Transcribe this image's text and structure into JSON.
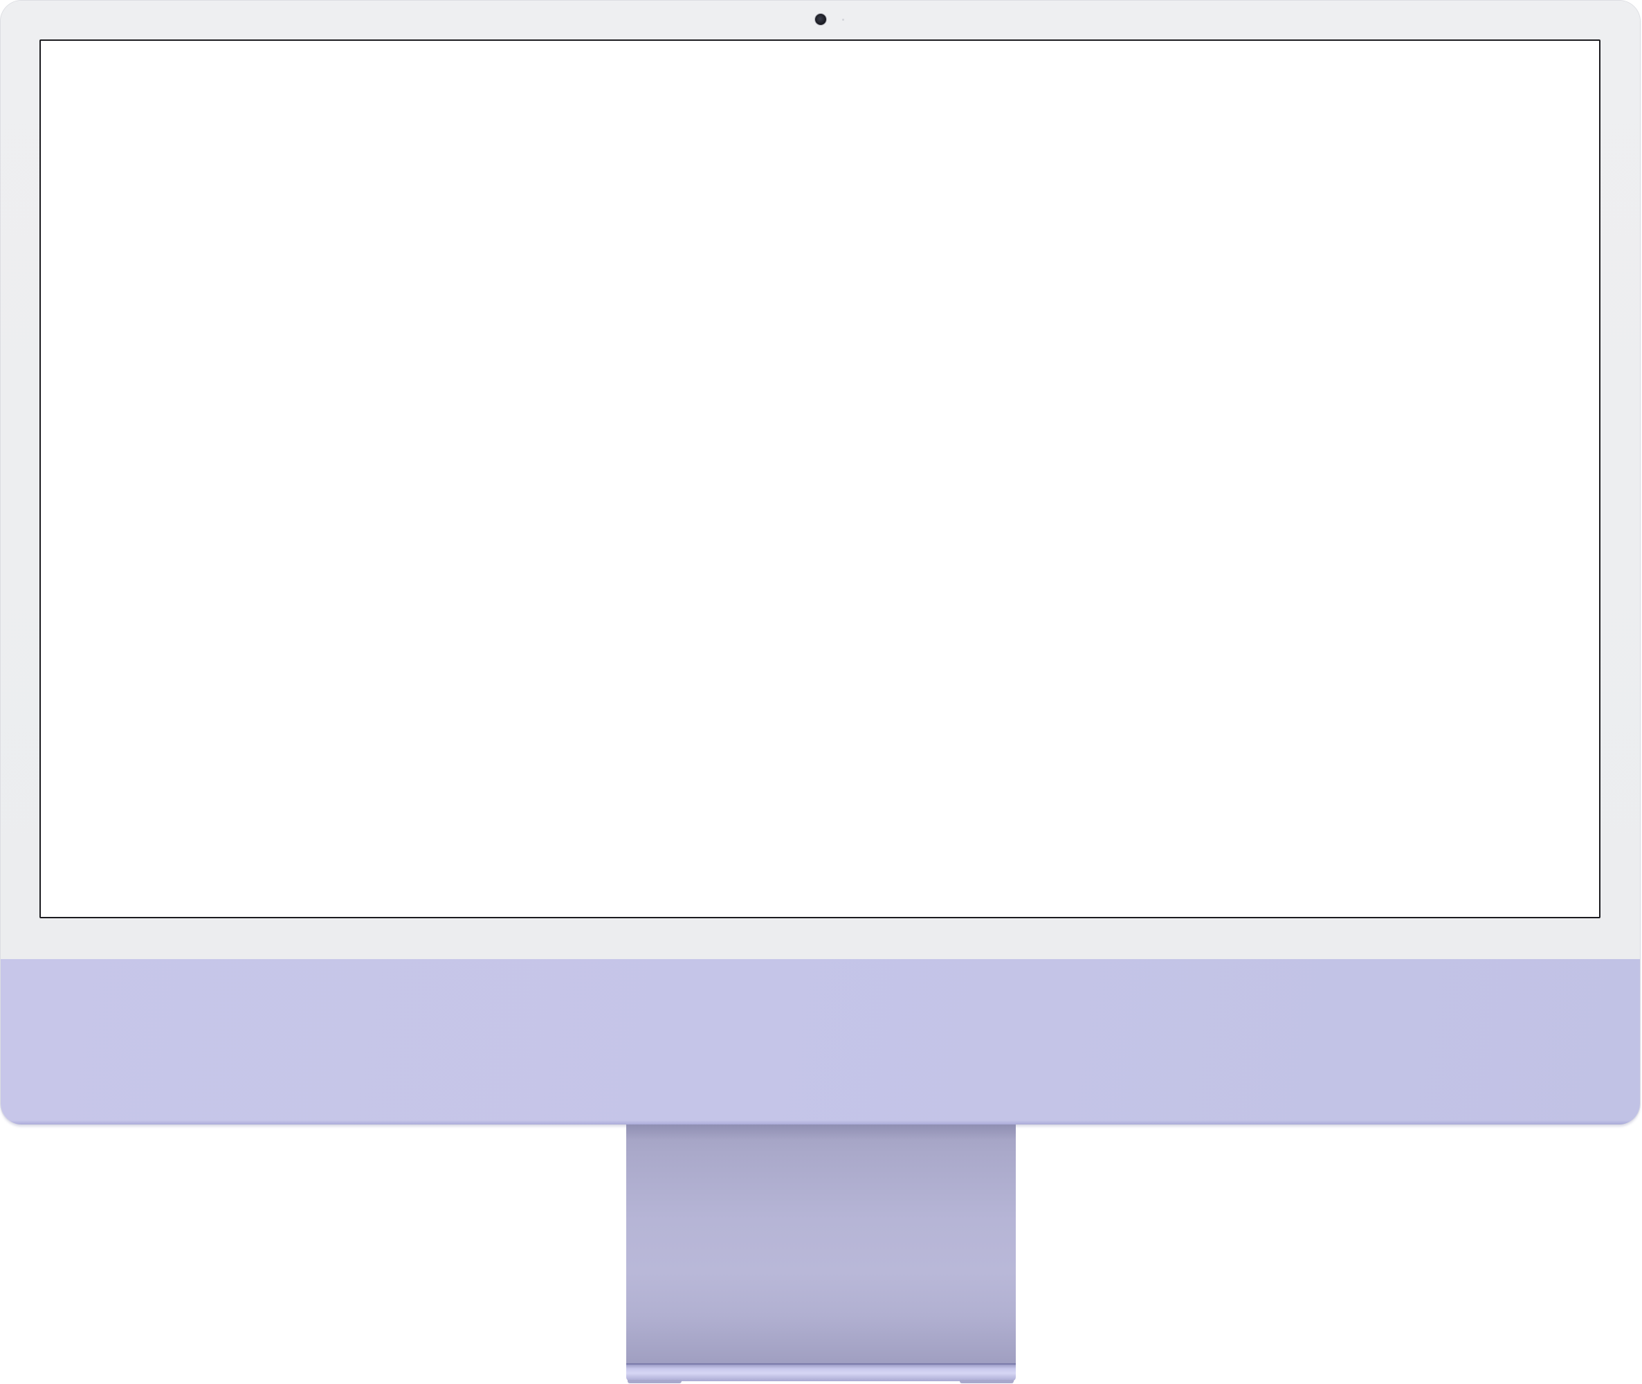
{
  "device": {
    "type": "imac",
    "colors": {
      "bezel": "#ECEDEF",
      "chin": "#C5C5E8",
      "stand": "#B6B5D6",
      "screen": "#FFFFFF",
      "screen_border": "#1B1B1F"
    },
    "icons": {
      "camera": "camera-icon"
    },
    "screen": {
      "content": ""
    }
  }
}
